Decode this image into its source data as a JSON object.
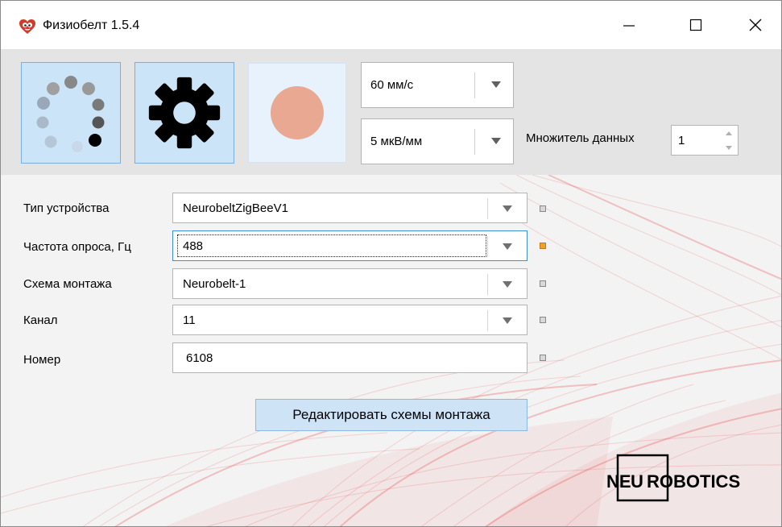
{
  "window": {
    "title": "Физиобелт 1.5.4",
    "icon": "heart-mascot-icon",
    "controls": [
      "minimize-icon",
      "maximize-icon",
      "close-icon"
    ]
  },
  "toolbar": {
    "buttons": [
      {
        "name": "connect",
        "icon": "loading-spinner-icon",
        "state": "pressed"
      },
      {
        "name": "settings",
        "icon": "gear-icon",
        "state": "pressed"
      },
      {
        "name": "record",
        "icon": "record-circle-icon",
        "state": "disabled"
      }
    ],
    "speed_value": "60 мм/с",
    "gain_value": "5 мкВ/мм",
    "multiplier_label": "Множитель данных",
    "multiplier_value": "1"
  },
  "form": {
    "fields": [
      {
        "label": "Тип устройства",
        "value": "NeurobeltZigBeeV1",
        "type": "combo",
        "indicator": "inactive"
      },
      {
        "label": "Частота опроса, Гц",
        "value": "488",
        "type": "combo",
        "indicator": "active",
        "focused": true
      },
      {
        "label": "Схема монтажа",
        "value": "Neurobelt-1",
        "type": "combo",
        "indicator": "inactive"
      },
      {
        "label": "Канал",
        "value": "11",
        "type": "combo",
        "indicator": "inactive"
      },
      {
        "label": "Номер",
        "value": "6108",
        "type": "text",
        "indicator": "inactive"
      }
    ],
    "edit_button_label": "Редактировать схемы монтажа"
  },
  "brand": {
    "logo_text_left": "NE",
    "logo_text_box": "U",
    "logo_text_right": "ROBOTICS"
  },
  "colors": {
    "accent_blue": "#cce4f7",
    "toolbar_bg": "#e4e4e4",
    "record_dot": "#e8a891",
    "indicator_active": "#f0a030",
    "background_art": "#e83a3a"
  }
}
